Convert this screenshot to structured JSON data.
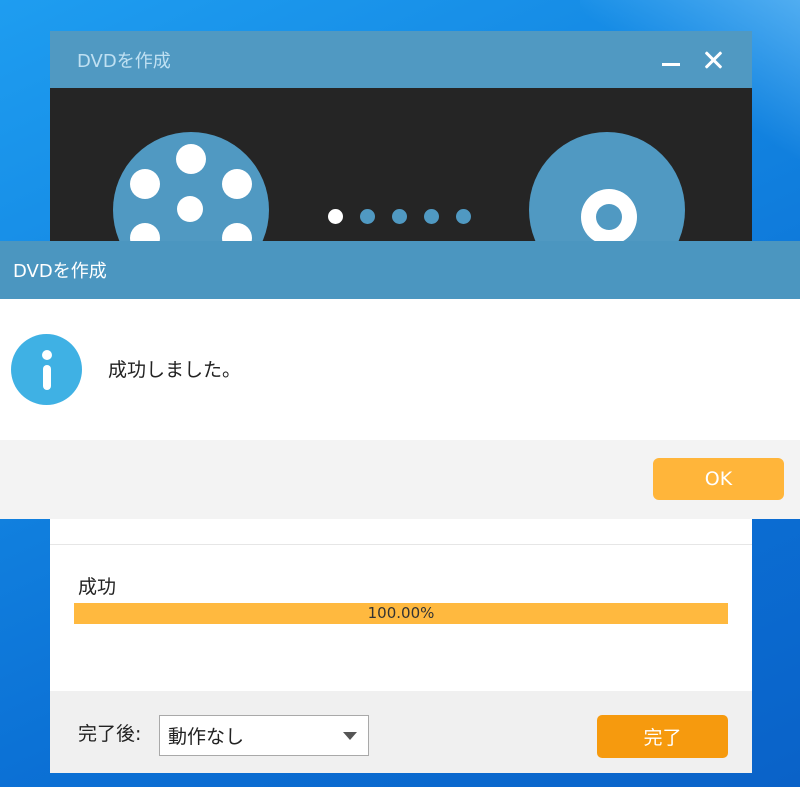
{
  "main_window": {
    "title": "DVDを作成",
    "minimize_icon": "minimize-icon",
    "close_icon": "close-icon",
    "carousel_dots": 5,
    "status": {
      "label": "成功",
      "progress_text": "100.00%",
      "progress_fraction": 1.0
    },
    "footer": {
      "after_label": "完了後:",
      "after_select": {
        "selected": "動作なし"
      },
      "done_button": "完了"
    }
  },
  "dialog": {
    "title": "DVDを作成",
    "icon": "info-icon",
    "message": "成功しました。",
    "ok_button": "OK"
  },
  "colors": {
    "titlebar": "#5099c2",
    "accent_orange": "#f69a0e",
    "progress": "#ffb93f",
    "ok_button": "#ffb53a",
    "info_icon": "#3fb1e4"
  }
}
